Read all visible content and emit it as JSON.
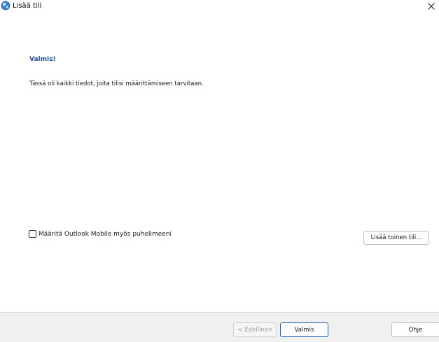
{
  "window": {
    "title": "Lisää tili",
    "icon": "outlook-globe-icon",
    "close_icon": "close-icon"
  },
  "content": {
    "heading": "Valmis!",
    "description": "Tässä oli kaikki tiedot, joita tilisi määrittämiseen tarvitaan."
  },
  "options": {
    "outlook_mobile_label": "Määritä Outlook Mobile myös puhelimeeni",
    "outlook_mobile_checked": false,
    "add_another_label": "Lisää toinen tili..."
  },
  "footer": {
    "back_label": "< Edellinen",
    "back_enabled": false,
    "finish_label": "Valmis",
    "help_label": "Ohje"
  },
  "colors": {
    "heading": "#1f4e9a",
    "footer_bg": "#f0f0f0",
    "default_button_border": "#1f5fb5"
  }
}
